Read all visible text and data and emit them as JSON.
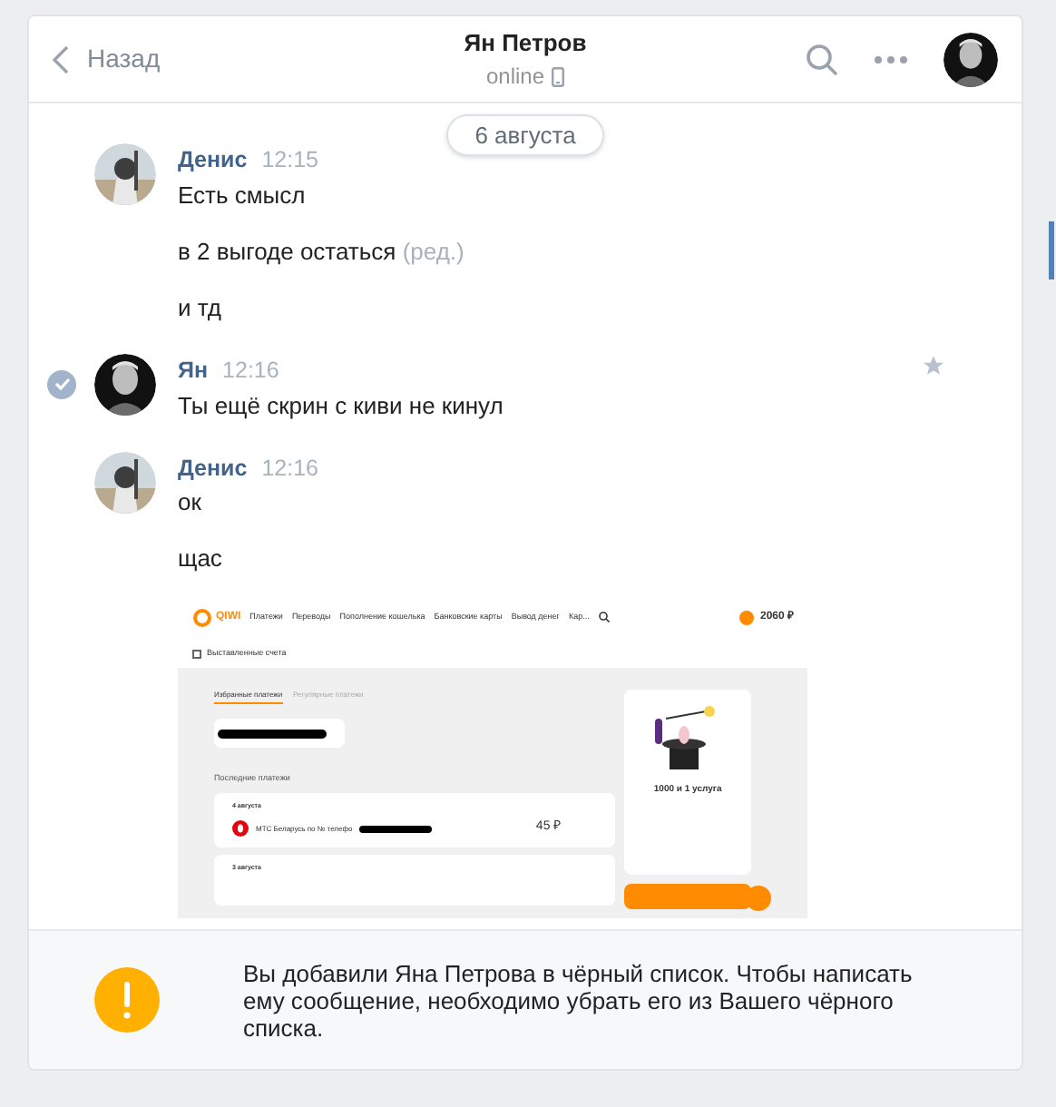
{
  "header": {
    "back": "Назад",
    "title": "Ян Петров",
    "status": "online"
  },
  "date": "6 августа",
  "messages": [
    {
      "author": "Денис",
      "time": "12:15",
      "kind": "own",
      "selected": false,
      "lines": [
        {
          "text": "Есть смысл"
        },
        {
          "text": "в 2 выгоде остаться",
          "edited": "(ред.)"
        },
        {
          "text": "и тд"
        }
      ]
    },
    {
      "author": "Ян",
      "time": "12:16",
      "kind": "contact",
      "selected": true,
      "lines": [
        {
          "text": "Ты ещё скрин с киви не кинул"
        }
      ]
    },
    {
      "author": "Денис",
      "time": "12:16",
      "kind": "own",
      "selected": false,
      "lines": [
        {
          "text": "ок"
        },
        {
          "text": "щас"
        }
      ],
      "attachment": {
        "kind": "screenshot",
        "logo": "QIWI",
        "nav": [
          "Платежи",
          "Переводы",
          "Пополнение кошелька",
          "Банковские карты",
          "Вывод денег",
          "Кар..."
        ],
        "balance": "2060 ₽",
        "bills": "Выставленные счета",
        "tabs": [
          {
            "label": "Избранные платежи",
            "selected": true
          },
          {
            "label": "Регулярные платежи",
            "selected": false
          }
        ],
        "recent_title": "Последние платежи",
        "payments": [
          {
            "date": "4 августа",
            "name": "МТС Беларусь по № телефо",
            "amount": "45 ₽"
          },
          {
            "date": "3 августа"
          }
        ],
        "promo": "1000 и 1 услуга"
      }
    }
  ],
  "notice": "Вы добавили Яна Петрова в чёрный список. Чтобы написать ему сообщение, необходимо убрать его из Вашего чёрного списка."
}
